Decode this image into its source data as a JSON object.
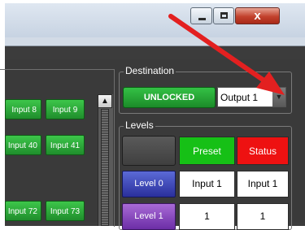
{
  "window": {
    "close_symbol": "x",
    "icons": [
      "minimize-icon",
      "maximize-icon",
      "close-icon"
    ]
  },
  "grid": {
    "row1": [
      "Input 8",
      "Input 9"
    ],
    "row2": [
      "Input 40",
      "Input 41"
    ],
    "row3": [
      "Input 72",
      "Input 73"
    ]
  },
  "destination": {
    "title": "Destination",
    "lock_label": "UNLOCKED",
    "output_value": "Output 1"
  },
  "levels": {
    "title": "Levels",
    "headers": {
      "preset": "Preset",
      "status": "Status"
    },
    "rows": [
      {
        "label": "Level 0",
        "preset": "Input 1",
        "status": "Input 1"
      },
      {
        "label": "Level 1",
        "preset": "1",
        "status": "1"
      }
    ]
  },
  "colors": {
    "unlocked_green": "#1f9a2c",
    "preset_green": "#16c016",
    "status_red": "#ee1111",
    "level0_blue": "#3a44b8",
    "level1_purple": "#8a48c2",
    "annotation_arrow": "#e32020"
  }
}
